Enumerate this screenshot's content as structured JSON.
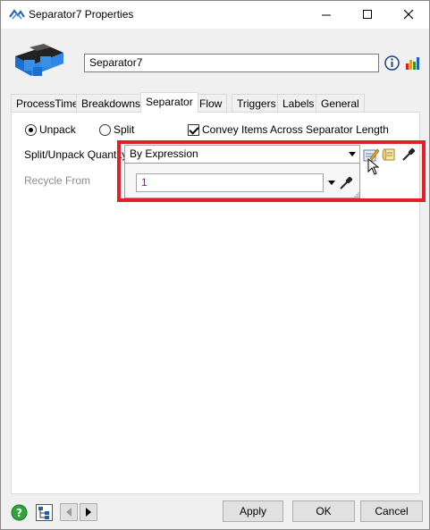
{
  "window": {
    "title": "Separator7  Properties"
  },
  "header": {
    "name_value": "Separator7"
  },
  "tabs": [
    {
      "label": "ProcessTimes"
    },
    {
      "label": "Breakdowns"
    },
    {
      "label": "Separator"
    },
    {
      "label": "Flow"
    },
    {
      "label": "Triggers"
    },
    {
      "label": "Labels"
    },
    {
      "label": "General"
    }
  ],
  "active_tab": "Separator",
  "separator": {
    "mode_unpack_label": "Unpack",
    "mode_split_label": "Split",
    "mode_selected": "Unpack",
    "convey_label": "Convey Items Across Separator Length",
    "convey_checked": true,
    "split_qty_label": "Split/Unpack Quantity",
    "split_qty_value": "By Expression",
    "recycle_label": "Recycle From",
    "expression_value": "1"
  },
  "footer": {
    "apply_label": "Apply",
    "ok_label": "OK",
    "cancel_label": "Cancel"
  },
  "colors": {
    "highlight": "#e0202a",
    "expression_text": "#b000b0"
  }
}
